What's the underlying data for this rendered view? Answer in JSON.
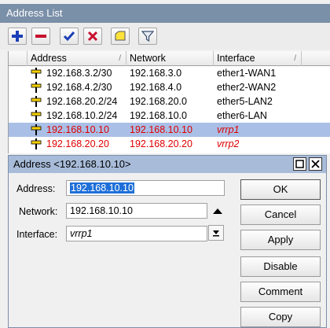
{
  "window": {
    "title": "Address List"
  },
  "table": {
    "columns": [
      "Address",
      "Network",
      "Interface"
    ],
    "rows": [
      {
        "address": "192.168.3.2/30",
        "network": "192.168.3.0",
        "interface": "ether1-WAN1"
      },
      {
        "address": "192.168.4.2/30",
        "network": "192.168.4.0",
        "interface": "ether2-WAN2"
      },
      {
        "address": "192.168.20.2/24",
        "network": "192.168.20.0",
        "interface": "ether5-LAN2"
      },
      {
        "address": "192.168.10.2/24",
        "network": "192.168.10.0",
        "interface": "ether6-LAN"
      },
      {
        "address": "192.168.10.10",
        "network": "192.168.10.10",
        "interface": "vrrp1"
      },
      {
        "address": "192.168.20.20",
        "network": "192.168.20.20",
        "interface": "vrrp2"
      }
    ]
  },
  "dialog": {
    "title": "Address <192.168.10.10>",
    "address_label": "Address:",
    "address_value": "192.168.10.10",
    "network_label": "Network:",
    "network_value": "192.168.10.10",
    "interface_label": "Interface:",
    "interface_value": "vrrp1",
    "buttons": {
      "ok": "OK",
      "cancel": "Cancel",
      "apply": "Apply",
      "disable": "Disable",
      "comment": "Comment",
      "copy": "Copy"
    }
  },
  "colors": {
    "titlebar": "#7a8fa8",
    "selected_row": "#a9bfe6",
    "dynamic_text": "#e00000",
    "selection": "#1e6fd8"
  }
}
